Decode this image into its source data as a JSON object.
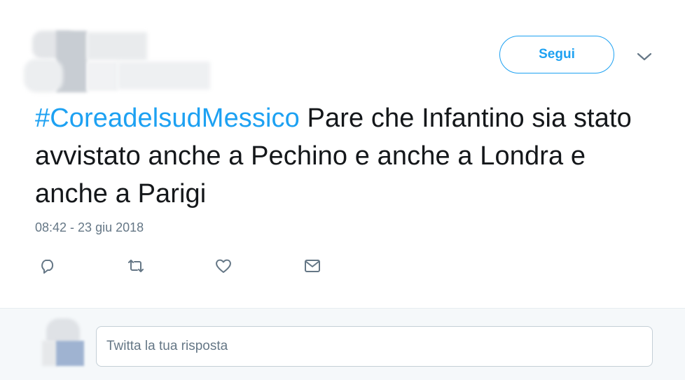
{
  "header": {
    "follow_label": "Segui"
  },
  "tweet": {
    "hashtag": "#CoreadelsudMessico",
    "text": " Pare che Infantino sia stato avvistato anche a Pechino e anche a Londra e anche a Parigi",
    "timestamp": "08:42 - 23 giu 2018"
  },
  "actions": [
    {
      "icon": "reply-icon"
    },
    {
      "icon": "retweet-icon"
    },
    {
      "icon": "like-icon"
    },
    {
      "icon": "direct-message-icon"
    }
  ],
  "reply": {
    "placeholder": "Twitta la tua risposta"
  },
  "colors": {
    "accent": "#1da1f2",
    "text": "#14171a",
    "secondary": "#657786",
    "reply_bg": "#f5f8fa"
  }
}
